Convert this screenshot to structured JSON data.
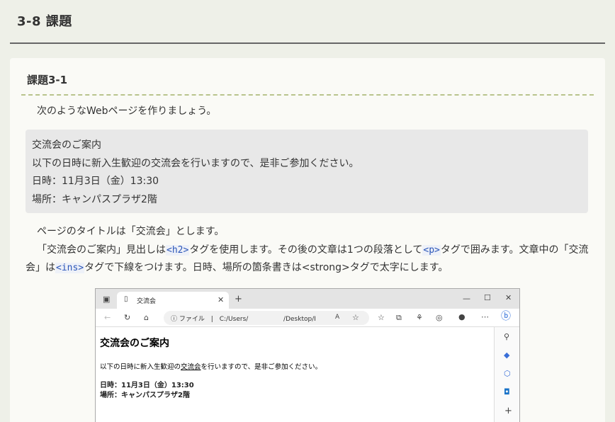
{
  "section": {
    "title": "3-8  課題"
  },
  "card": {
    "title": "課題3-1",
    "intro": "次のようなWebページを作りましょう。",
    "sample": [
      "交流会のご案内",
      "以下の日時に新入生歓迎の交流会を行いますので、是非ご参加ください。",
      "日時：11月3日（金）13:30",
      "場所：キャンパスプラザ2階"
    ],
    "para1": "ページのタイトルは「交流会」とします。",
    "para2": {
      "t1": "「交流会のご案内」見出しは",
      "code1": "<h2>",
      "t2": "タグを使用します。その後の文章は1つの段落として",
      "code2": "<p>",
      "t3": "タグで囲みます。文章中の「交流会」は",
      "code3": "<ins>",
      "t4": "タグで下線をつけます。日時、場所の箇条書きは<strong>タグで太字にします。"
    }
  },
  "browser": {
    "tab_title": "交流会",
    "url_label": "ファイル",
    "url_path1": "C:/Users/",
    "url_path2": "/Desktop/I",
    "page": {
      "heading": "交流会のご案内",
      "p_before": "以下の日時に新入生歓迎の",
      "p_ins": "交流会",
      "p_after": "を行いますので、是非ご参加ください。",
      "date": "日時：11月3日（金）13:30",
      "place": "場所：キャンパスプラザ2階"
    }
  }
}
